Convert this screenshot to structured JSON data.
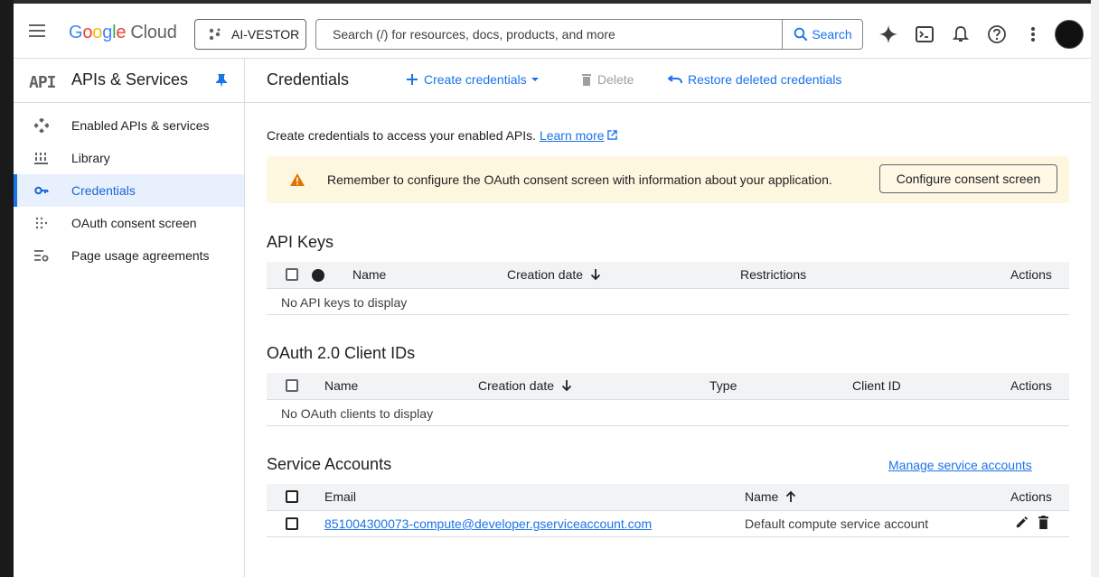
{
  "header": {
    "logo_g": "G",
    "logo_o1": "o",
    "logo_o2": "o",
    "logo_g2": "g",
    "logo_l": "l",
    "logo_e": "e",
    "logo_cloud": "Cloud",
    "project": "AI-VESTOR",
    "search_placeholder": "Search (/) for resources, docs, products, and more",
    "search_button": "Search"
  },
  "sidebar": {
    "api_logo": "API",
    "title": "APIs & Services",
    "items": [
      {
        "label": "Enabled APIs & services",
        "icon": "diamond-dots-icon"
      },
      {
        "label": "Library",
        "icon": "library-icon"
      },
      {
        "label": "Credentials",
        "icon": "key-icon",
        "active": true
      },
      {
        "label": "OAuth consent screen",
        "icon": "dots-grid-icon"
      },
      {
        "label": "Page usage agreements",
        "icon": "settings-list-icon"
      }
    ]
  },
  "main": {
    "title": "Credentials",
    "create_label": "Create credentials",
    "delete_label": "Delete",
    "restore_label": "Restore deleted credentials",
    "intro": "Create credentials to access your enabled APIs.",
    "learn_more": "Learn more",
    "banner_text": "Remember to configure the OAuth consent screen with information about your application.",
    "banner_button": "Configure consent screen"
  },
  "api_keys": {
    "title": "API Keys",
    "columns": [
      "Name",
      "Creation date",
      "Restrictions",
      "Actions"
    ],
    "empty": "No API keys to display"
  },
  "oauth": {
    "title": "OAuth 2.0 Client IDs",
    "columns": [
      "Name",
      "Creation date",
      "Type",
      "Client ID",
      "Actions"
    ],
    "empty": "No OAuth clients to display"
  },
  "service_accounts": {
    "title": "Service Accounts",
    "manage_link": "Manage service accounts",
    "columns": [
      "Email",
      "Name",
      "Actions"
    ],
    "rows": [
      {
        "email": "851004300073-compute@developer.gserviceaccount.com",
        "name": "Default compute service account"
      }
    ]
  },
  "colors": {
    "accent": "#1a73e8",
    "warning": "#e37400",
    "banner_bg": "#fef7e0"
  }
}
